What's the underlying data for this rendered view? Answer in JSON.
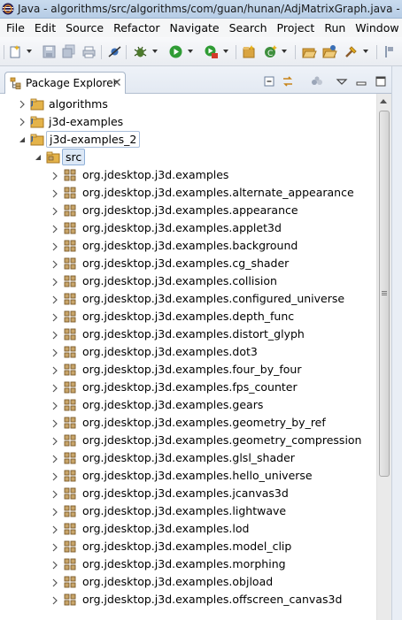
{
  "window": {
    "title": "Java - algorithms/src/algorithms/com/guan/hunan/AdjMatrixGraph.java - E"
  },
  "menu": {
    "items": [
      "File",
      "Edit",
      "Source",
      "Refactor",
      "Navigate",
      "Search",
      "Project",
      "Run",
      "Window"
    ]
  },
  "toolbar": {
    "icons": [
      "new-wizard-icon",
      "save-icon",
      "save-all-icon",
      "print-icon",
      "skip-breakpoints-icon",
      "debug-icon",
      "run-icon",
      "external-tools-icon",
      "new-java-project-icon",
      "new-java-class-icon",
      "open-type-icon",
      "open-task-icon",
      "search-icon",
      "annotation-icon"
    ]
  },
  "view": {
    "tab_label": "Package Explorer",
    "buttons": [
      "collapse-all-icon",
      "link-with-editor-icon",
      "focus-active-task-icon",
      "view-menu-icon",
      "minimize-icon",
      "maximize-icon"
    ]
  },
  "tree": {
    "projects": [
      {
        "label": "algorithms",
        "expanded": false
      },
      {
        "label": "j3d-examples",
        "expanded": false
      },
      {
        "label": "j3d-examples_2",
        "expanded": true
      }
    ],
    "source_folder": "src",
    "packages": [
      "org.jdesktop.j3d.examples",
      "org.jdesktop.j3d.examples.alternate_appearance",
      "org.jdesktop.j3d.examples.appearance",
      "org.jdesktop.j3d.examples.applet3d",
      "org.jdesktop.j3d.examples.background",
      "org.jdesktop.j3d.examples.cg_shader",
      "org.jdesktop.j3d.examples.collision",
      "org.jdesktop.j3d.examples.configured_universe",
      "org.jdesktop.j3d.examples.depth_func",
      "org.jdesktop.j3d.examples.distort_glyph",
      "org.jdesktop.j3d.examples.dot3",
      "org.jdesktop.j3d.examples.four_by_four",
      "org.jdesktop.j3d.examples.fps_counter",
      "org.jdesktop.j3d.examples.gears",
      "org.jdesktop.j3d.examples.geometry_by_ref",
      "org.jdesktop.j3d.examples.geometry_compression",
      "org.jdesktop.j3d.examples.glsl_shader",
      "org.jdesktop.j3d.examples.hello_universe",
      "org.jdesktop.j3d.examples.jcanvas3d",
      "org.jdesktop.j3d.examples.lightwave",
      "org.jdesktop.j3d.examples.lod",
      "org.jdesktop.j3d.examples.model_clip",
      "org.jdesktop.j3d.examples.morphing",
      "org.jdesktop.j3d.examples.objload",
      "org.jdesktop.j3d.examples.offscreen_canvas3d"
    ]
  }
}
